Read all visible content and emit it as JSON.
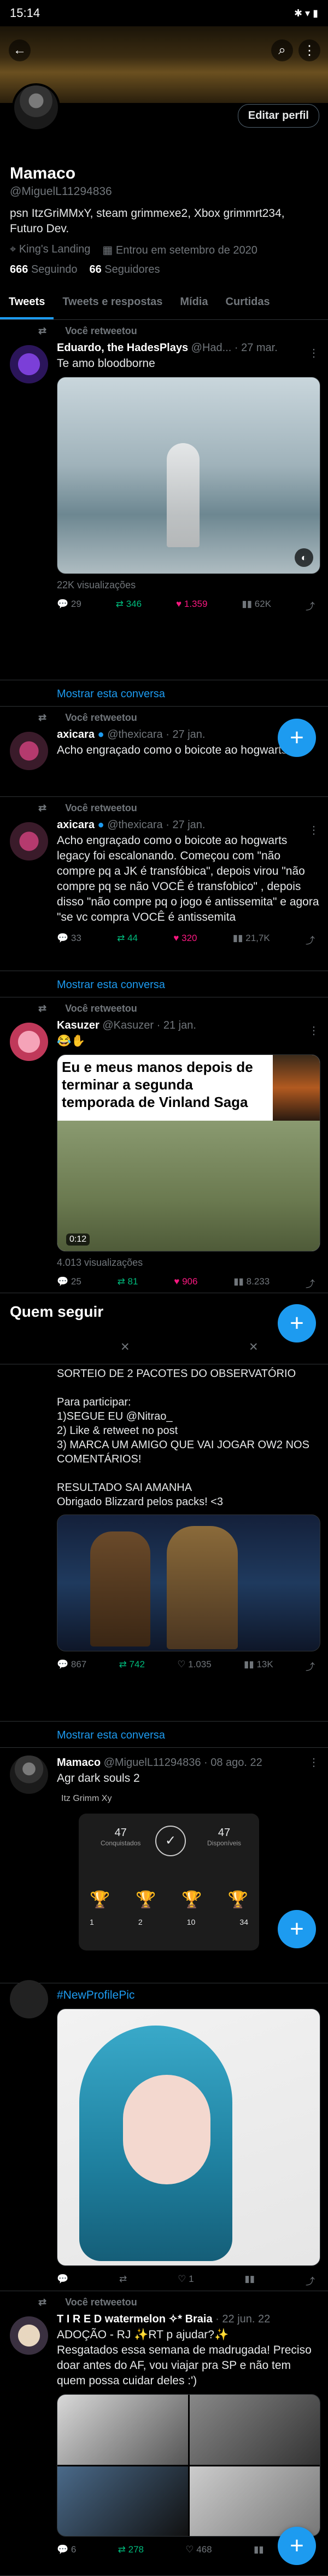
{
  "status": {
    "time": "15:14",
    "icons": "✱ ▾ ▮"
  },
  "profile": {
    "name": "Mamaco",
    "handle": "@MiguelL11294836",
    "bio": "psn ItzGriMMxY, steam grimmexe2, Xbox grimmrt234, Futuro Dev.",
    "location": "King's Landing",
    "joined": "Entrou em setembro de 2020",
    "following_count": "666",
    "following_label": "Seguindo",
    "followers_count": "66",
    "followers_label": "Seguidores",
    "edit_label": "Editar perfil"
  },
  "tabs": [
    "Tweets",
    "Tweets e respostas",
    "Mídia",
    "Curtidas"
  ],
  "rt_label": "Você retweetou",
  "tweets": [
    {
      "author": "Eduardo, the HadesPlays",
      "handle": "@Had...",
      "date": "27 mar.",
      "text": "Te amo bloodborne",
      "views": "22K visualizações",
      "replies": "29",
      "retweets": "346",
      "likes": "1.359",
      "stats": "62K"
    },
    {
      "author": "axicara",
      "handle": "@thexicara",
      "date": "27 jan.",
      "text": "Acho engraçado como o boicote ao hogwarts"
    },
    {
      "author": "axicara",
      "handle": "@thexicara",
      "date": "27 jan.",
      "text": "Acho engraçado como o boicote ao hogwarts legacy foi escalonando. Começou com \"não compre pq a JK é transfóbica\", depois virou \"não compre pq se não VOCÊ é transfobico\" , depois disso \"não compre pq o jogo é antissemita\" e agora \"se vc compra VOCÊ é antissemita",
      "replies": "33",
      "retweets": "44",
      "likes": "320",
      "stats": "21,7K"
    },
    {
      "author": "Kasuzer",
      "handle": "@Kasuzer",
      "date": "21 jan.",
      "text": "😂✋",
      "meme": "Eu e meus manos depois de terminar a segunda temporada de Vinland Saga",
      "duration": "0:12",
      "views": "4.013 visualizações",
      "replies": "25",
      "retweets": "81",
      "likes": "906",
      "stats": "8.233"
    },
    {
      "author": "",
      "text": "SORTEIO DE 2 PACOTES DO OBSERVATÓRIO\n\nPara participar:\n1)SEGUE EU @Nitrao_\n2) Like & retweet no post\n3) MARCA UM AMIGO QUE VAI JOGAR OW2 NOS COMENTÁRIOS!\n\nRESULTADO SAI AMANHA\nObrigado Blizzard pelos packs! <3",
      "replies": "867",
      "retweets": "742",
      "likes": "1.035",
      "stats": "13K"
    },
    {
      "author": "Mamaco",
      "handle": "@MiguelL11294836",
      "date": "08 ago. 22",
      "text": "Agr dark souls 2",
      "card_user": "Itz Grimm Xy",
      "ach_done": "47",
      "ach_done_label": "Conquistados",
      "ach_avail": "47",
      "ach_avail_label": "Disponíveis",
      "trophies": [
        "1",
        "2",
        "10",
        "34"
      ]
    },
    {
      "author": "",
      "text": "#NewProfilePic",
      "replies": "",
      "retweets": "",
      "likes": "1",
      "stats": ""
    },
    {
      "author": "T I R E D watermelon ✧* Braia",
      "handle": "",
      "date": "22 jun. 22",
      "text": "ADOÇÃO - RJ ✨RT p ajudar?✨\nResgatados essa semana de madrugada! Preciso doar antes do AF, vou viajar pra SP e não tem quem possa cuidar deles :')",
      "replies": "6",
      "retweets": "278",
      "likes": "468",
      "stats": ""
    }
  ],
  "show_conversation": "Mostrar esta conversa",
  "who_to_follow": "Quem seguir",
  "colors": {
    "accent": "#1d9bf0",
    "like": "#f91880",
    "retweet": "#00ba7c",
    "muted": "#71767b"
  }
}
